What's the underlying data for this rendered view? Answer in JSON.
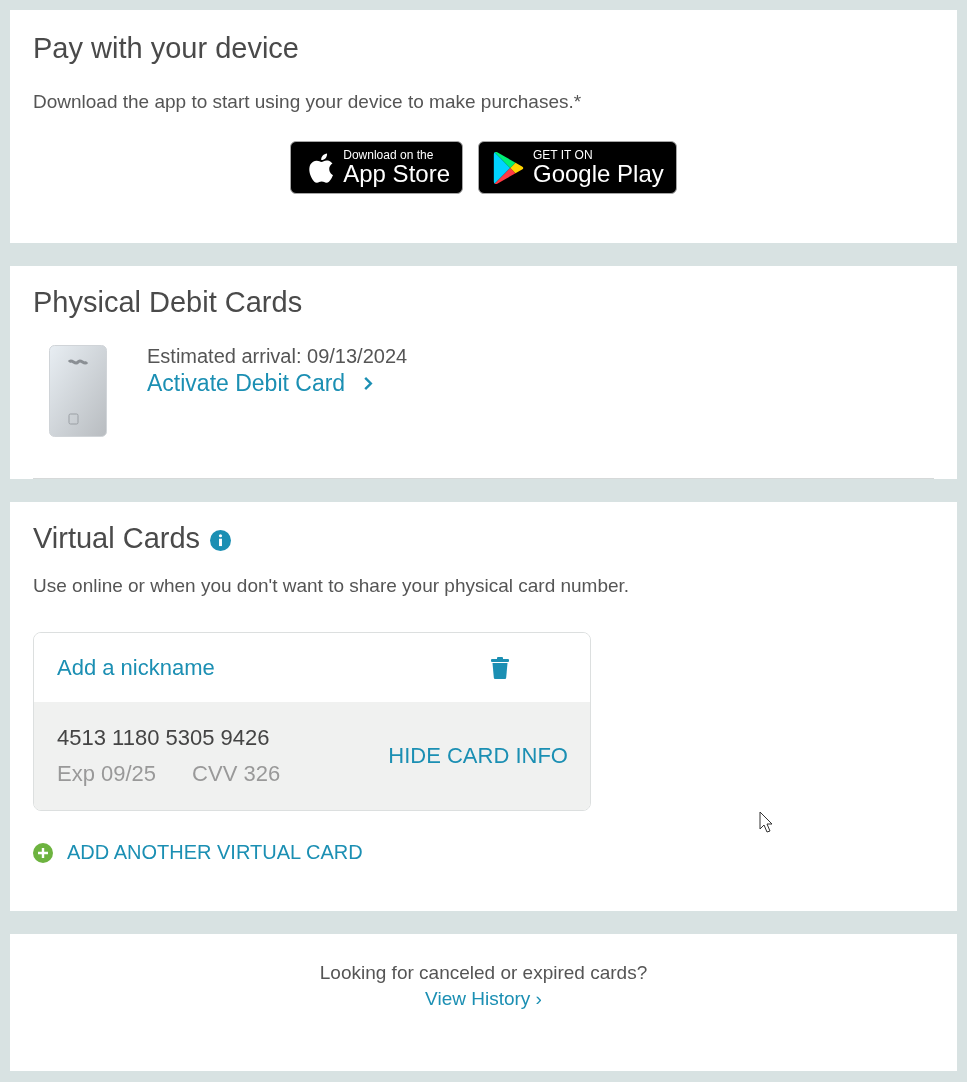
{
  "pay_device": {
    "title": "Pay with your device",
    "text": "Download the app to start using your device to make purchases.*",
    "badges": [
      {
        "kind": "apple",
        "small": "Download on the",
        "big": "App Store"
      },
      {
        "kind": "google",
        "small": "GET IT ON",
        "big": "Google Play"
      }
    ]
  },
  "physical_cards": {
    "title": "Physical Debit Cards",
    "arrival": "Estimated arrival: 09/13/2024",
    "link": "Activate Debit Card"
  },
  "virtual_cards": {
    "title": "Virtual Cards",
    "text": "Use online or when you don't want to share your physical card number.",
    "cards": [
      {
        "nickname": "Add a nickname",
        "number": "4513 1180 5305 9426",
        "exp": "Exp 09/25",
        "cvv": "CVV 326",
        "toggle": "HIDE CARD INFO"
      }
    ],
    "add_link": "ADD ANOTHER VIRTUAL CARD"
  },
  "history": {
    "text": "Looking for canceled or expired cards?",
    "link": "View History ›"
  }
}
